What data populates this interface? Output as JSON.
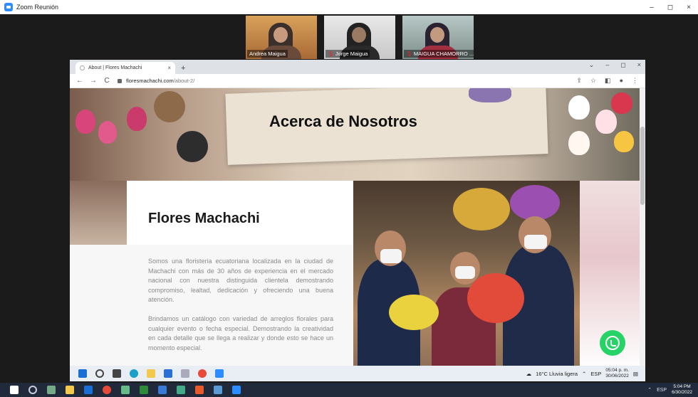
{
  "zoom": {
    "title": "Zoom Reunión",
    "minimize": "–",
    "maximize": "◻",
    "close": "×",
    "participants": [
      {
        "name": "Andrea Maigua",
        "muted": false
      },
      {
        "name": "Jorge Maigua",
        "muted": true
      },
      {
        "name": "MAIGUA CHAMORRO ...",
        "muted": true
      }
    ]
  },
  "browser": {
    "tab_title": "About | Flores Machachi",
    "tab_close": "×",
    "new_tab": "+",
    "url_host": "floresmachachi.com",
    "url_path": "/about-2/",
    "nav": {
      "back": "←",
      "forward": "→",
      "reload": "C"
    },
    "window": {
      "dropdown": "⌄",
      "minimize": "–",
      "maximize": "◻",
      "close": "×"
    }
  },
  "page": {
    "hero_title": "Acerca de Nosotros",
    "card_title": "Flores Machachi",
    "paragraph1": "Somos una floristeria ecuatoriana localizada en la ciudad de Machachi con más de 30 años de experiencia en el mercado nacional con nuestra distinguida clientela demostrando compromiso, lealtad, dedicación y ofreciendo una buena atención.",
    "paragraph2": "Brindamos un catálogo con variedad de arreglos florales para cualquier evento o fecha especial. Demostrando la creatividad en cada detalle que se llega a realizar y donde esto se hace un momento especial."
  },
  "remote_taskbar": {
    "weather": "16°C Lluvia ligera",
    "lang": "ESP",
    "time": "05:04 p. m.",
    "date": "30/06/2022"
  },
  "local_taskbar": {
    "lang": "ESP",
    "time": "5:04 PM",
    "date": "6/30/2022"
  },
  "colors": {
    "whatsapp": "#25d366",
    "zoom_blue": "#2d8cff"
  }
}
